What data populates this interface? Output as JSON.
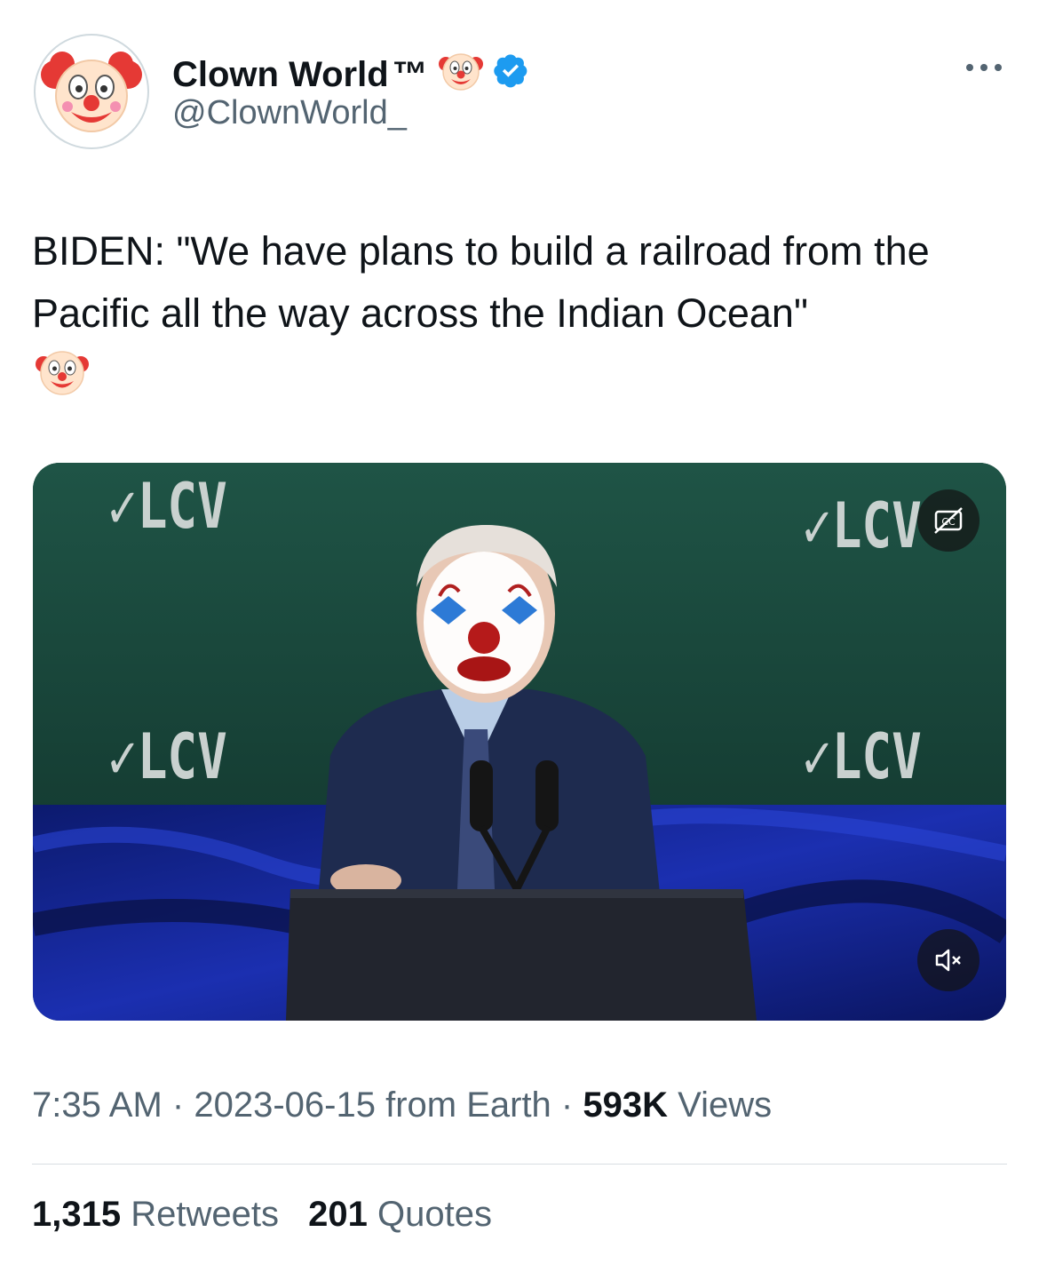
{
  "author": {
    "display_name": "Clown World",
    "trademark": "™",
    "handle": "@ClownWorld_",
    "verified": true,
    "avatar_icon": "clown-face-icon"
  },
  "tweet": {
    "text": "BIDEN: \"We have plans to build a railroad from the Pacific all the way across the Indian Ocean\"",
    "trailing_emoji": "clown-face-emoji"
  },
  "media": {
    "type": "video",
    "backdrop_logo_text": "✓LCV",
    "captions_icon": "captions-off-icon",
    "mute_icon": "speaker-muted-icon"
  },
  "meta": {
    "time": "7:35 AM",
    "date": "2023-06-15",
    "source": "from Earth",
    "views_count": "593K",
    "views_label": "Views",
    "separator": "·"
  },
  "stats": {
    "retweets_count": "1,315",
    "retweets_label": "Retweets",
    "quotes_count": "201",
    "quotes_label": "Quotes"
  },
  "colors": {
    "verified": "#1d9bf0",
    "secondary_text": "#536471",
    "primary_text": "#0f1419"
  }
}
